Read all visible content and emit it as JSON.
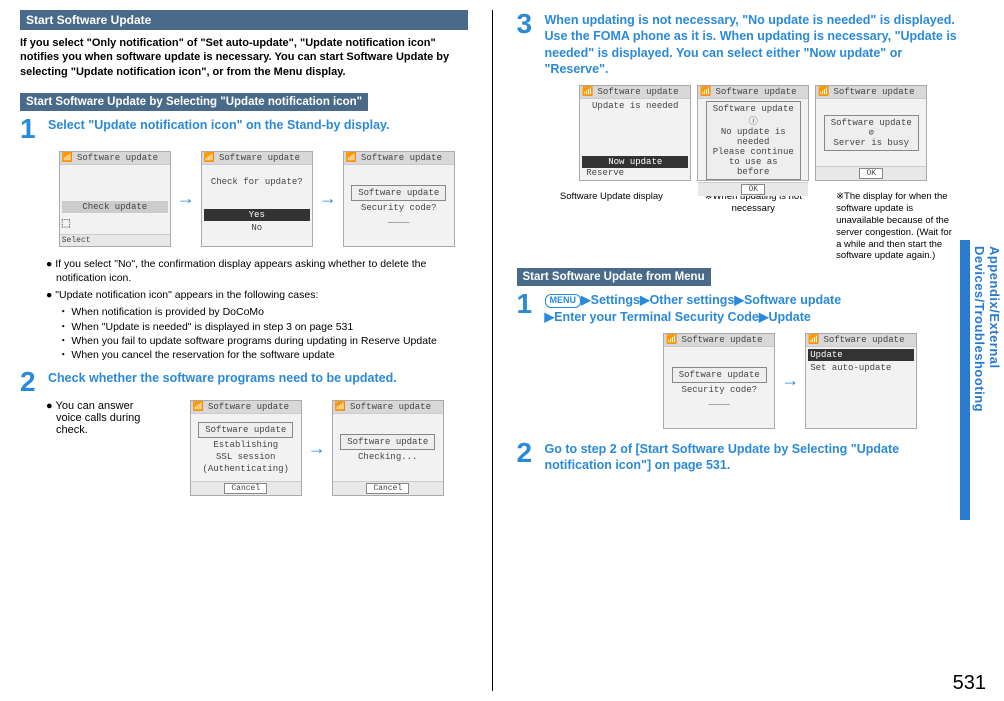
{
  "left": {
    "header": "Start Software Update",
    "intro": "If you select \"Only notification\" of \"Set auto-update\", \"Update notification icon\" notifies you when software update is necessary. You can start Software Update by selecting \"Update notification icon\", or from the Menu display.",
    "sub1": "Start Software Update by Selecting \"Update notification icon\"",
    "step1": {
      "num": "1",
      "title": "Select \"Update notification icon\" on the Stand-by display.",
      "bullets": [
        "If you select \"No\", the confirmation display appears asking whether to delete the notification icon.",
        "\"Update notification icon\" appears in the following cases:"
      ],
      "subbullets": [
        "When notification is provided by DoCoMo",
        "When \"Update is needed\" is displayed in step 3 on page 531",
        "When you fail to update software programs during updating in Reserve Update",
        "When you cancel the reservation for the software update"
      ],
      "screens": {
        "a_title": "Software update",
        "a_line1": "Check update",
        "a_footer": "Select",
        "b_title": "Software update",
        "b_line1": "Check for update?",
        "b_yes": "Yes",
        "b_no": "No",
        "c_title": "Software update",
        "c_box": "Software update",
        "c_line1": "Security code?",
        "c_line2": "____"
      }
    },
    "step2": {
      "num": "2",
      "title": "Check whether the software programs need to be updated.",
      "note": "You can answer voice calls during check.",
      "screens": {
        "a_title": "Software update",
        "a_box": "Software update",
        "a_line1": "Establishing",
        "a_line2": "SSL session",
        "a_line3": "(Authenticating)",
        "a_btn": "Cancel",
        "b_title": "Software update",
        "b_box": "Software update",
        "b_line1": "Checking...",
        "b_btn": "Cancel"
      }
    }
  },
  "right": {
    "step3": {
      "num": "3",
      "title": "When updating is not necessary, \"No update is needed\" is displayed. Use the FOMA phone as it is. When updating is necessary, \"Update is needed\" is displayed. You can select either \"Now update\" or \"Reserve\".",
      "screens": {
        "a_title": "Software update",
        "a_line1": "Update is needed",
        "a_hl": "Now update",
        "a_line2": "Reserve",
        "b_title": "Software update",
        "b_box": "Software update",
        "b_icon": "ⓘ",
        "b_line1": "No update is",
        "b_line2": "needed",
        "b_line3": "Please continue",
        "b_line4": "to use as before",
        "b_btn": "OK",
        "c_title": "Software update",
        "c_box": "Software update",
        "c_icon": "⊘",
        "c_line1": "Server is busy",
        "c_btn": "OK"
      },
      "captions": {
        "a": "Software Update display",
        "b": "※When updating is not necessary",
        "c": "※The display for when the software update is unavailable because of the server congestion. (Wait for a while and then start the software update again.)"
      }
    },
    "sub2": "Start Software Update from Menu",
    "step1b": {
      "num": "1",
      "menu": "MENU",
      "path": [
        "Settings",
        "Other settings",
        "Software update",
        "Enter your Terminal Security Code",
        "Update"
      ],
      "screens": {
        "a_title": "Software update",
        "a_box": "Software update",
        "a_line1": "Security code?",
        "a_line2": "____",
        "b_title": "Software update",
        "b_hl": "Update",
        "b_line2": "Set auto-update"
      }
    },
    "step2b": {
      "num": "2",
      "title": "Go to step 2 of [Start Software Update by Selecting \"Update notification icon\"] on page 531."
    }
  },
  "sideTab": "Appendix/External Devices/Troubleshooting",
  "pageNum": "531"
}
